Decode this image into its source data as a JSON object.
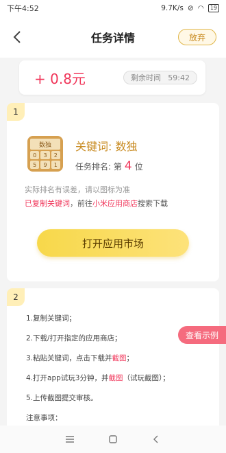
{
  "status": {
    "time": "下午4:52",
    "speed": "9.7K/s",
    "battery": "19"
  },
  "header": {
    "title": "任务详情",
    "giveup_label": "放弃"
  },
  "reward": {
    "amount": "+ 0.8元",
    "time_label": "剩余时间",
    "time_value": "59:42"
  },
  "card1": {
    "step": "1",
    "app_icon_title": "数独",
    "app_icon_digits": [
      "0",
      "3",
      "2",
      "5",
      "9",
      "1"
    ],
    "keyword": "关键词: 数独",
    "rank_label": "任务排名: 第",
    "rank_value": "4",
    "rank_unit": "位",
    "note_line1": "实际排名有误差，请以图标为准",
    "copied_label": "已复制关键词",
    "note_mid": "，前往",
    "store_name": "小米应用商店",
    "note_end": "搜索下载",
    "open_button": "打开应用市场"
  },
  "card2": {
    "step": "2",
    "line1": "1.复制关键词；",
    "line2": "2.下载/打开指定的应用商店；",
    "line3_a": "3.粘贴关键词，点击下载并",
    "line3_b": "截图",
    "line3_c": "；",
    "line4_a": "4.打开app试玩3分钟，并",
    "line4_b": "截图",
    "line4_c": "（试玩截图）；",
    "line5": "5.上传截图提交审核。",
    "line6": "注意事项："
  },
  "example_button": "查看示例",
  "colors": {
    "accent": "#f0365a",
    "gold": "#c88a1f",
    "button_yellow": "#f7d84a",
    "example_pink": "#f56b7e"
  }
}
